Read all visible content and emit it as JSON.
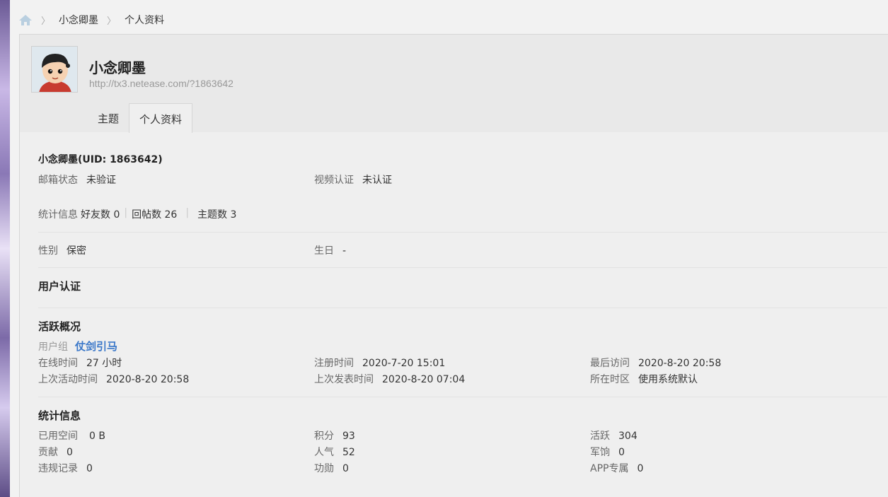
{
  "breadcrumb": {
    "home_icon": "home-icon",
    "items": [
      "小念卿墨",
      "个人资料"
    ]
  },
  "profile": {
    "name": "小念卿墨",
    "url": "http://tx3.netease.com/?1863642",
    "tabs": [
      "主题",
      "个人资料"
    ],
    "active_tab": "个人资料"
  },
  "basic": {
    "name_uid": "小念卿墨(UID: 1863642)",
    "email_label": "邮箱状态",
    "email_value": "未验证",
    "video_label": "视频认证",
    "video_value": "未认证",
    "stats_label": "统计信息",
    "friends": "好友数 0",
    "replies": "回帖数 26",
    "threads": "主题数 3",
    "gender_label": "性别",
    "gender_value": "保密",
    "birthday_label": "生日",
    "birthday_value": "-"
  },
  "user_cert": {
    "title": "用户认证"
  },
  "activity": {
    "title": "活跃概况",
    "group_label": "用户组",
    "group_value": "仗剑引马",
    "online_label": "在线时间",
    "online_value": "27 小时",
    "reg_label": "注册时间",
    "reg_value": "2020-7-20 15:01",
    "last_visit_label": "最后访问",
    "last_visit_value": "2020-8-20 20:58",
    "last_active_label": "上次活动时间",
    "last_active_value": "2020-8-20 20:58",
    "last_post_label": "上次发表时间",
    "last_post_value": "2020-8-20 07:04",
    "tz_label": "所在时区",
    "tz_value": "使用系统默认"
  },
  "stats": {
    "title": "统计信息",
    "space_label": "已用空间",
    "space_value": "0 B",
    "points_label": "积分",
    "points_value": "93",
    "active_label": "活跃",
    "active_value": "304",
    "contrib_label": "贡献",
    "contrib_value": "0",
    "pop_label": "人气",
    "pop_value": "52",
    "pay_label": "军饷",
    "pay_value": "0",
    "violation_label": "违规记录",
    "violation_value": "0",
    "merit_label": "功勋",
    "merit_value": "0",
    "app_label": "APP专属",
    "app_value": "0"
  },
  "colors": {
    "accent": "#3b78c9",
    "panel": "#efefef",
    "header": "#e9e9e9"
  }
}
